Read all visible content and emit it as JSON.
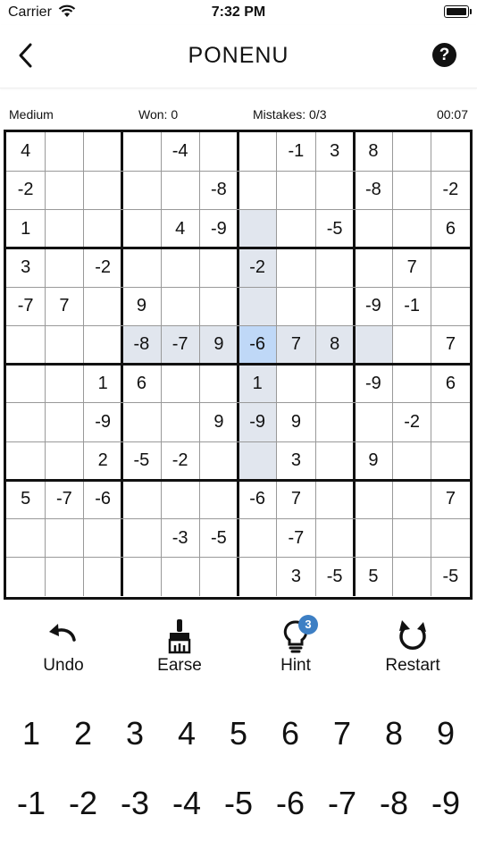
{
  "status": {
    "carrier": "Carrier",
    "time": "7:32 PM"
  },
  "nav": {
    "title": "PONENU",
    "help": "?"
  },
  "info": {
    "difficulty": "Medium",
    "won": "Won: 0",
    "mistakes": "Mistakes: 0/3",
    "timer": "00:07"
  },
  "board": {
    "cols": 12,
    "rows": 12,
    "cells": [
      [
        "4",
        "",
        "",
        "",
        "-4",
        "",
        "",
        "-1",
        "3",
        "8",
        "",
        ""
      ],
      [
        "-2",
        "",
        "",
        "",
        "",
        "-8",
        "",
        "",
        "",
        "-8",
        "",
        "-2"
      ],
      [
        "1",
        "",
        "",
        "",
        "4",
        "-9",
        "",
        "",
        "-5",
        "",
        "",
        "6"
      ],
      [
        "3",
        "",
        "-2",
        "",
        "",
        "",
        "-2",
        "",
        "",
        "",
        "7",
        ""
      ],
      [
        "-7",
        "7",
        "",
        "9",
        "",
        "",
        "",
        "",
        "",
        "-9",
        "-1",
        ""
      ],
      [
        "",
        "",
        "",
        "-8",
        "-7",
        "9",
        "-6",
        "7",
        "8",
        "",
        "",
        "7"
      ],
      [
        "",
        "",
        "1",
        "6",
        "",
        "",
        "1",
        "",
        "",
        "-9",
        "",
        "6"
      ],
      [
        "",
        "",
        "-9",
        "",
        "",
        "9",
        "-9",
        "9",
        "",
        "",
        "-2",
        ""
      ],
      [
        "",
        "",
        "2",
        "-5",
        "-2",
        "",
        "",
        "3",
        "",
        "9",
        "",
        ""
      ],
      [
        "5",
        "-7",
        "-6",
        "",
        "",
        "",
        "-6",
        "7",
        "",
        "",
        "",
        "7"
      ],
      [
        "",
        "",
        "",
        "",
        "-3",
        "-5",
        "",
        "-7",
        "",
        "",
        "",
        ""
      ],
      [
        "",
        "",
        "",
        "",
        "",
        "",
        "",
        "3",
        "-5",
        "5",
        "",
        "-5"
      ]
    ],
    "highlighted_cells": [
      [
        2,
        6
      ],
      [
        3,
        6
      ],
      [
        4,
        6
      ],
      [
        5,
        3
      ],
      [
        5,
        4
      ],
      [
        5,
        5
      ],
      [
        5,
        7
      ],
      [
        5,
        8
      ],
      [
        5,
        9
      ],
      [
        6,
        6
      ],
      [
        7,
        6
      ],
      [
        8,
        6
      ]
    ],
    "selected_cell": [
      5,
      6
    ],
    "highlight_color": "#e1e6ee",
    "selected_color": "#bfd8f7"
  },
  "tools": [
    {
      "id": "undo",
      "label": "Undo",
      "icon": "undo-icon"
    },
    {
      "id": "erase",
      "label": "Earse",
      "icon": "broom-icon"
    },
    {
      "id": "hint",
      "label": "Hint",
      "icon": "lightbulb-icon",
      "badge": "3"
    },
    {
      "id": "restart",
      "label": "Restart",
      "icon": "restart-icon"
    }
  ],
  "numpad": {
    "positive": [
      "1",
      "2",
      "3",
      "4",
      "5",
      "6",
      "7",
      "8",
      "9"
    ],
    "negative": [
      "-1",
      "-2",
      "-3",
      "-4",
      "-5",
      "-6",
      "-7",
      "-8",
      "-9"
    ]
  }
}
